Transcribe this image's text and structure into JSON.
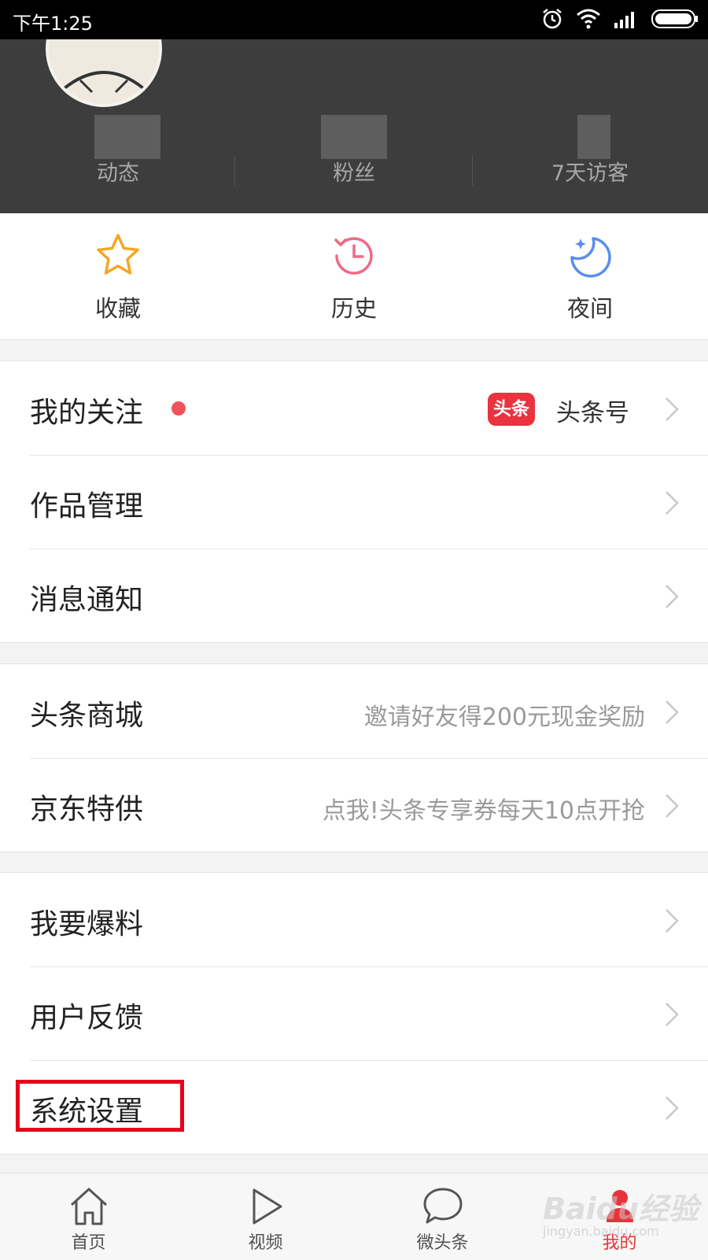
{
  "status_bar": {
    "time": "下午1:25"
  },
  "profile": {
    "stats": [
      {
        "label": "动态"
      },
      {
        "label": "粉丝"
      },
      {
        "label": "7天访客"
      }
    ]
  },
  "quick_actions": [
    {
      "label": "收藏",
      "icon": "star-icon",
      "color": "#f5a623"
    },
    {
      "label": "历史",
      "icon": "history-clock-icon",
      "color": "#ee6a86"
    },
    {
      "label": "夜间",
      "icon": "moon-icon",
      "color": "#5b8def"
    }
  ],
  "menu_group_1": [
    {
      "title": "我的关注",
      "badge": "头条",
      "right_label": "头条号"
    },
    {
      "title": "作品管理"
    },
    {
      "title": "消息通知"
    }
  ],
  "menu_group_2": [
    {
      "title": "头条商城",
      "right_text": "邀请好友得200元现金奖励"
    },
    {
      "title": "京东特供",
      "right_text": "点我!头条专享券每天10点开抢"
    }
  ],
  "menu_group_3": [
    {
      "title": "我要爆料"
    },
    {
      "title": "用户反馈"
    },
    {
      "title": "系统设置"
    }
  ],
  "tab_bar": [
    {
      "label": "首页",
      "icon": "home-icon"
    },
    {
      "label": "视频",
      "icon": "play-icon"
    },
    {
      "label": "微头条",
      "icon": "chat-bubble-icon"
    },
    {
      "label": "我的",
      "icon": "person-icon",
      "active": true
    }
  ],
  "watermark": {
    "brand": "Baidu经验",
    "url": "jingyan.baidu.com"
  },
  "colors": {
    "accent_red": "#e8333a",
    "highlight_box": "#e8001c",
    "notice_dot": "#f0545b"
  }
}
